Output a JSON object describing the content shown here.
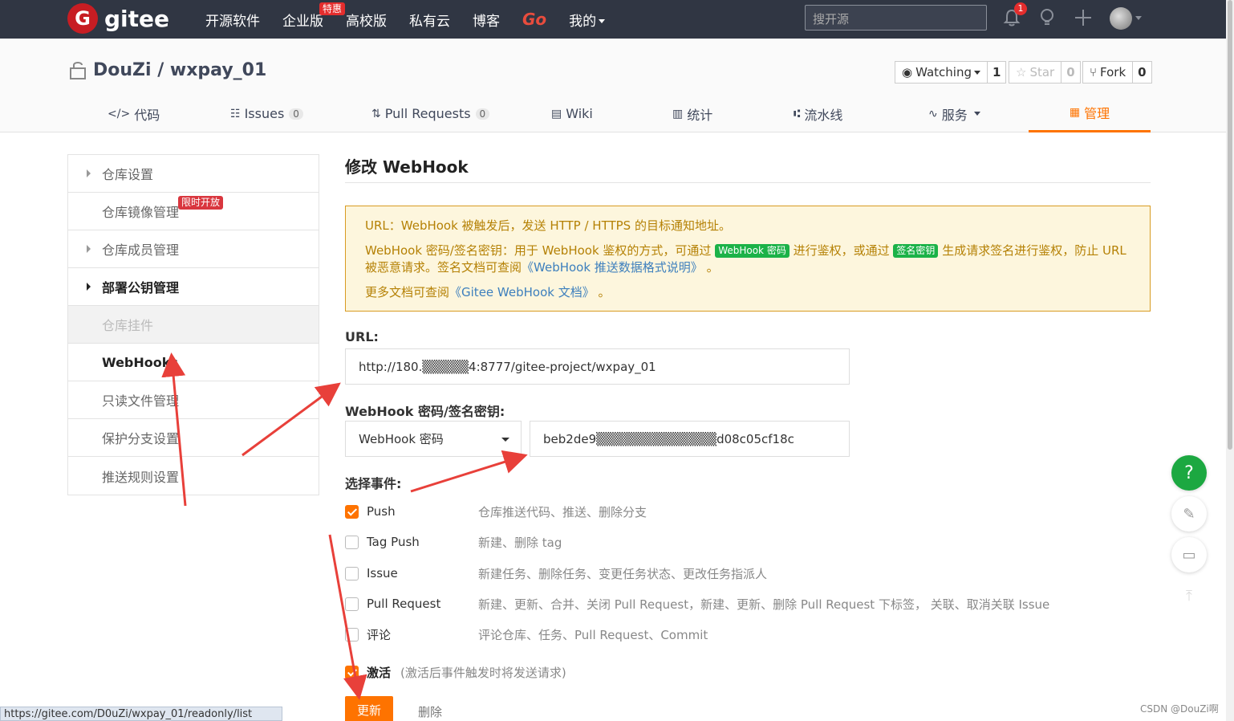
{
  "nav": {
    "logo_text": "gitee",
    "logo_mark": "G",
    "items": [
      "开源软件",
      "企业版",
      "高校版",
      "私有云",
      "博客",
      "Go",
      "我的"
    ],
    "enterprise_badge": "特惠",
    "search_placeholder": "搜开源",
    "notification_count": "1"
  },
  "repo": {
    "title": "DouZi / wxpay_01",
    "watching_label": "Watching",
    "watching_count": "1",
    "star_label": "Star",
    "star_count": "0",
    "fork_label": "Fork",
    "fork_count": "0"
  },
  "tabs": [
    {
      "label": "代码",
      "icon": "code-icon"
    },
    {
      "label": "Issues",
      "count": "0",
      "icon": "issues-icon"
    },
    {
      "label": "Pull Requests",
      "count": "0",
      "icon": "pull-request-icon"
    },
    {
      "label": "Wiki",
      "icon": "wiki-icon"
    },
    {
      "label": "统计",
      "icon": "stats-icon"
    },
    {
      "label": "流水线",
      "icon": "pipeline-icon"
    },
    {
      "label": "服务",
      "icon": "service-icon"
    },
    {
      "label": "管理",
      "icon": "manage-icon"
    }
  ],
  "sidebar": {
    "items": [
      {
        "label": "仓库设置"
      },
      {
        "label": "仓库镜像管理",
        "badge": "限时开放"
      },
      {
        "label": "仓库成员管理"
      },
      {
        "label": "部署公钥管理"
      },
      {
        "label": "仓库挂件"
      },
      {
        "label": "WebHooks"
      },
      {
        "label": "只读文件管理"
      },
      {
        "label": "保护分支设置"
      },
      {
        "label": "推送规则设置"
      }
    ]
  },
  "main": {
    "title": "修改 WebHook",
    "notice": {
      "line1": "URL：WebHook 被触发后，发送 HTTP / HTTPS 的目标通知地址。",
      "line2_a": "WebHook 密码/签名密钥：用于 WebHook 鉴权的方式，可通过",
      "tag_password": "WebHook 密码",
      "line2_b": "进行鉴权，或通过",
      "tag_sign": "签名密钥",
      "line2_c": "生成请求签名进行鉴权，防止 URL 被恶意请求。签名文档可查阅",
      "link_format": "《WebHook 推送数据格式说明》",
      "line2_end": "。",
      "line3_a": "更多文档可查阅",
      "link_docs": "《Gitee WebHook 文档》",
      "line3_end": "。"
    },
    "url_label": "URL:",
    "url_value": "http://180.▒▒▒▒▒4:8777/gitee-project/wxpay_01",
    "secret_label": "WebHook 密码/签名密钥:",
    "secret_type": "WebHook 密码",
    "secret_value": "beb2de9▒▒▒▒▒▒▒▒▒▒▒▒▒d08c05cf18c",
    "events_label": "选择事件:",
    "events": [
      {
        "name": "Push",
        "desc": "仓库推送代码、推送、删除分支",
        "checked": true
      },
      {
        "name": "Tag Push",
        "desc": "新建、删除 tag",
        "checked": false
      },
      {
        "name": "Issue",
        "desc": "新建任务、删除任务、变更任务状态、更改任务指派人",
        "checked": false
      },
      {
        "name": "Pull Request",
        "desc": "新建、更新、合并、关闭 Pull Request，新建、更新、删除 Pull Request 下标签， 关联、取消关联 Issue",
        "checked": false
      },
      {
        "name": "评论",
        "desc": "评论仓库、任务、Pull Request、Commit",
        "checked": false
      }
    ],
    "active_label": "激活",
    "active_desc": "(激活后事件触发时将发送请求)",
    "update_button": "更新",
    "delete_button": "删除"
  },
  "status_url": "https://gitee.com/D0uZi/wxpay_01/readonly/list",
  "watermark": "CSDN @DouZi啊",
  "colors": {
    "accent": "#fe7300",
    "nav_bg": "#303643",
    "brand_red": "#c71d23",
    "annotation_red": "#e8403a"
  }
}
